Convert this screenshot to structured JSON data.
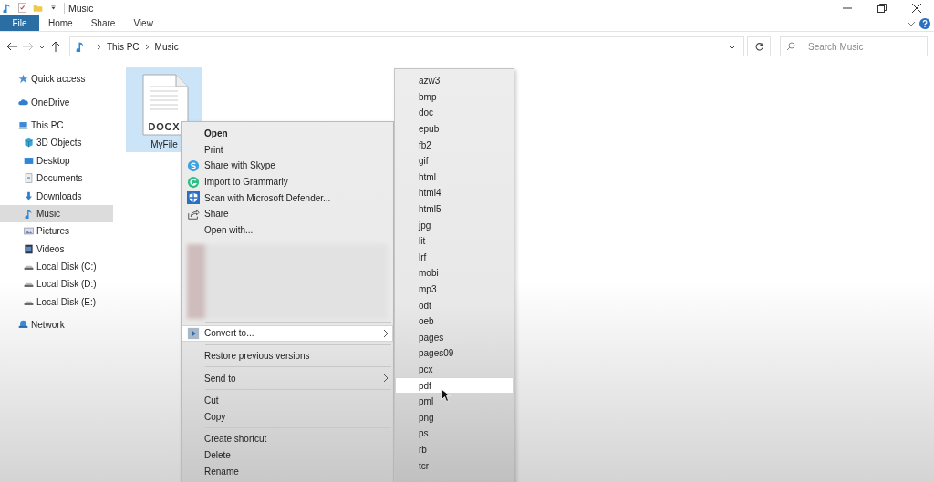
{
  "window": {
    "title": "Music"
  },
  "ribbon_tabs": [
    {
      "label": "File",
      "selected": true
    },
    {
      "label": "Home",
      "selected": false
    },
    {
      "label": "Share",
      "selected": false
    },
    {
      "label": "View",
      "selected": false
    }
  ],
  "address_bar": {
    "path": [
      "This PC",
      "Music"
    ]
  },
  "search": {
    "placeholder": "Search Music"
  },
  "sidebar": {
    "items": [
      {
        "label": "Quick access",
        "selected": false
      },
      {
        "label": "OneDrive",
        "selected": false
      },
      {
        "label": "This PC",
        "selected": false,
        "children": [
          {
            "label": "3D Objects",
            "selected": false
          },
          {
            "label": "Desktop",
            "selected": false
          },
          {
            "label": "Documents",
            "selected": false
          },
          {
            "label": "Downloads",
            "selected": false
          },
          {
            "label": "Music",
            "selected": true
          },
          {
            "label": "Pictures",
            "selected": false
          },
          {
            "label": "Videos",
            "selected": false
          },
          {
            "label": "Local Disk (C:)",
            "selected": false
          },
          {
            "label": "Local Disk (D:)",
            "selected": false
          },
          {
            "label": "Local Disk (E:)",
            "selected": false
          }
        ]
      },
      {
        "label": "Network",
        "selected": false
      }
    ]
  },
  "files": [
    {
      "name": "MyFile",
      "type_label": "DOCX",
      "selected": true
    }
  ],
  "context_menu": {
    "items": [
      {
        "kind": "item",
        "label": "Open",
        "bold": true,
        "selected": false
      },
      {
        "kind": "item",
        "label": "Print",
        "selected": false
      },
      {
        "kind": "item",
        "label": "Share with Skype",
        "selected": false
      },
      {
        "kind": "item",
        "label": "Import to Grammarly",
        "selected": false
      },
      {
        "kind": "item",
        "label": "Scan with Microsoft Defender...",
        "selected": false
      },
      {
        "kind": "item",
        "label": "Share",
        "selected": false
      },
      {
        "kind": "item",
        "label": "Open with...",
        "selected": false
      },
      {
        "kind": "separator"
      },
      {
        "kind": "blurred"
      },
      {
        "kind": "separator"
      },
      {
        "kind": "item",
        "label": "Convert to...",
        "submenu": true,
        "selected": true
      },
      {
        "kind": "separator"
      },
      {
        "kind": "item",
        "label": "Restore previous versions",
        "selected": false
      },
      {
        "kind": "separator"
      },
      {
        "kind": "item",
        "label": "Send to",
        "submenu": true,
        "selected": false
      },
      {
        "kind": "separator"
      },
      {
        "kind": "item",
        "label": "Cut",
        "selected": false
      },
      {
        "kind": "item",
        "label": "Copy",
        "selected": false
      },
      {
        "kind": "separator"
      },
      {
        "kind": "item",
        "label": "Create shortcut",
        "selected": false
      },
      {
        "kind": "item",
        "label": "Delete",
        "selected": false
      },
      {
        "kind": "item",
        "label": "Rename",
        "selected": false
      }
    ]
  },
  "convert_submenu": {
    "items": [
      {
        "label": "azw3",
        "selected": false
      },
      {
        "label": "bmp",
        "selected": false
      },
      {
        "label": "doc",
        "selected": false
      },
      {
        "label": "epub",
        "selected": false
      },
      {
        "label": "fb2",
        "selected": false
      },
      {
        "label": "gif",
        "selected": false
      },
      {
        "label": "html",
        "selected": false
      },
      {
        "label": "html4",
        "selected": false
      },
      {
        "label": "html5",
        "selected": false
      },
      {
        "label": "jpg",
        "selected": false
      },
      {
        "label": "lit",
        "selected": false
      },
      {
        "label": "lrf",
        "selected": false
      },
      {
        "label": "mobi",
        "selected": false
      },
      {
        "label": "mp3",
        "selected": false
      },
      {
        "label": "odt",
        "selected": false
      },
      {
        "label": "oeb",
        "selected": false
      },
      {
        "label": "pages",
        "selected": false
      },
      {
        "label": "pages09",
        "selected": false
      },
      {
        "label": "pcx",
        "selected": false
      },
      {
        "label": "pdf",
        "selected": true
      },
      {
        "label": "pml",
        "selected": false
      },
      {
        "label": "png",
        "selected": false
      },
      {
        "label": "ps",
        "selected": false
      },
      {
        "label": "rb",
        "selected": false
      },
      {
        "label": "tcr",
        "selected": false
      }
    ]
  }
}
